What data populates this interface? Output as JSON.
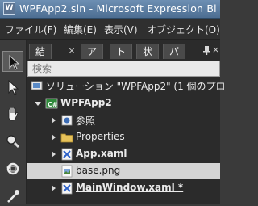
{
  "window": {
    "title": "WPFApp2.sln - Microsoft Expression Bl",
    "app_icon_glyph": "W"
  },
  "menu": {
    "items": [
      {
        "label": "ファイル(F)"
      },
      {
        "label": "編集(E)"
      },
      {
        "label": "表示(V)"
      },
      {
        "label": "オブジェクト(O)"
      }
    ]
  },
  "tools": [
    {
      "name": "selection-tool",
      "icon": "arrow-pointer-icon",
      "selected": true
    },
    {
      "name": "direct-selection-tool",
      "icon": "white-arrow-icon"
    },
    {
      "name": "pan-tool",
      "icon": "hand-icon"
    },
    {
      "name": "zoom-tool",
      "icon": "magnifier-icon"
    },
    {
      "name": "camera-orbit-tool",
      "icon": "orbit-icon"
    },
    {
      "name": "eyedropper-tool",
      "icon": "eyedropper-icon"
    }
  ],
  "panel": {
    "tabs": [
      {
        "label": "結",
        "active": true
      },
      {
        "label": "ア"
      },
      {
        "label": "ト"
      },
      {
        "label": "状"
      },
      {
        "label": "パ"
      }
    ],
    "tab_close_glyph": "×",
    "panel_close_glyph": "×",
    "search_placeholder": "検索"
  },
  "tree": [
    {
      "label": "ソリューション \"WPFApp2\" (1 個のプロ",
      "icon": "solution-icon",
      "indent": 0,
      "arrow": "none",
      "bold": false
    },
    {
      "label": "WPFApp2",
      "icon": "csharp-project-icon",
      "indent": 1,
      "arrow": "expanded",
      "bold": true
    },
    {
      "label": "参照",
      "icon": "references-icon",
      "indent": 2,
      "arrow": "collapsed",
      "bold": false
    },
    {
      "label": "Properties",
      "icon": "folder-icon",
      "indent": 2,
      "arrow": "collapsed",
      "bold": false
    },
    {
      "label": "App.xaml",
      "icon": "xaml-file-icon",
      "indent": 2,
      "arrow": "collapsed",
      "bold": true
    },
    {
      "label": "base.png",
      "icon": "image-file-icon",
      "indent": 2,
      "arrow": "none",
      "bold": false,
      "selected": true
    },
    {
      "label": "MainWindow.xaml *",
      "icon": "xaml-file-icon",
      "indent": 2,
      "arrow": "collapsed",
      "bold": true,
      "underline": true
    }
  ],
  "colors": {
    "titlebar": "#5b7ea3",
    "background": "#2b2b2b",
    "selection": "#d4d4d4"
  }
}
